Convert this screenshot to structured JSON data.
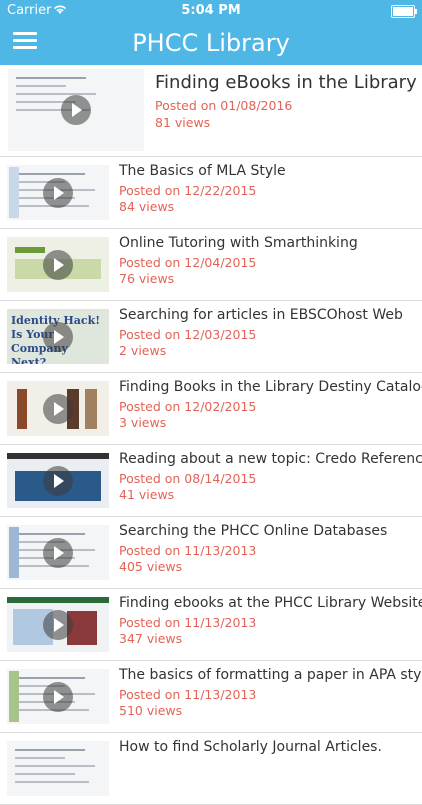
{
  "status_bar": {
    "carrier": "Carrier",
    "time": "5:04 PM"
  },
  "header": {
    "title": "PHCC Library"
  },
  "videos": [
    {
      "title": "Finding eBooks in the Library",
      "date": "Posted on 01/08/2016",
      "views": "81 views"
    },
    {
      "title": "The Basics of MLA Style",
      "date": "Posted on 12/22/2015",
      "views": "84 views"
    },
    {
      "title": "Online Tutoring with Smarthinking",
      "date": "Posted on 12/04/2015",
      "views": "76 views"
    },
    {
      "title": "Searching for articles in EBSCOhost Web",
      "date": "Posted on 12/03/2015",
      "views": "2 views"
    },
    {
      "title": "Finding Books in the Library Destiny Catalog",
      "date": "Posted on 12/02/2015",
      "views": "3 views"
    },
    {
      "title": "Reading about a new topic: Credo Reference",
      "date": "Posted on 08/14/2015",
      "views": "41 views"
    },
    {
      "title": "Searching the PHCC Online Databases",
      "date": "Posted on 11/13/2013",
      "views": "405 views"
    },
    {
      "title": "Finding ebooks at the PHCC Library Website",
      "date": "Posted on 11/13/2013",
      "views": "347 views"
    },
    {
      "title": "The basics of formatting a paper in APA style",
      "date": "Posted on 11/13/2013",
      "views": "510 views"
    },
    {
      "title": "How to find Scholarly Journal Articles.",
      "date": "",
      "views": ""
    }
  ],
  "thumbnail_texts": {
    "identity_hack": "Identity Hack! Is Your Company Next?"
  },
  "colors": {
    "header": "#4fb7e6",
    "date_text": "#e26357",
    "title_text": "#333333"
  }
}
